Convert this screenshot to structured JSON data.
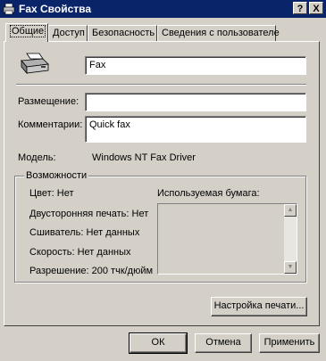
{
  "window": {
    "title": "Fax Свойства",
    "help_label": "?",
    "close_label": "X"
  },
  "tabs": [
    {
      "label": "Общие"
    },
    {
      "label": "Доступ"
    },
    {
      "label": "Безопасность"
    },
    {
      "label": "Сведения с пользователе"
    }
  ],
  "general": {
    "printer_name": "Fax",
    "location_label": "Размещение:",
    "location_value": "",
    "comment_label": "Комментарии:",
    "comment_value": "Quick fax",
    "model_label": "Модель:",
    "model_value": "Windows NT Fax Driver"
  },
  "features": {
    "title": "Возможности",
    "color": "Цвет: Нет",
    "duplex": "Двусторонняя печать: Нет",
    "staple": "Сшиватель: Нет данных",
    "speed": "Скорость: Нет данных",
    "resolution": "Разрешение: 200 тчк/дюйм",
    "paper_label": "Используемая бумага:"
  },
  "buttons": {
    "print_setup": "Настройка печати...",
    "ok": "ОК",
    "cancel": "Отмена",
    "apply": "Применить"
  }
}
